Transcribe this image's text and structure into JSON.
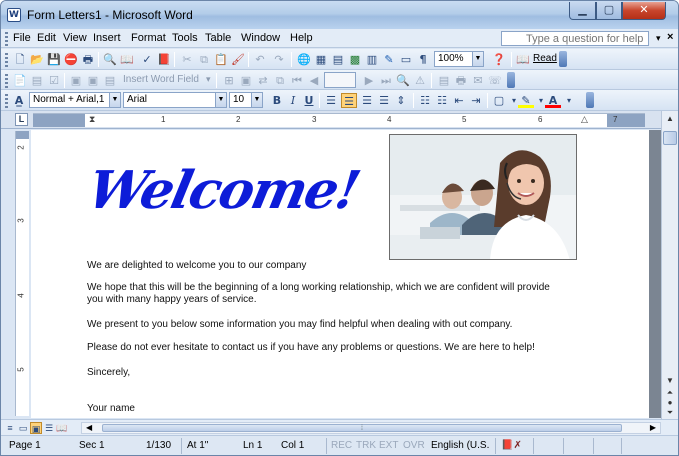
{
  "window": {
    "title": "Form Letters1 - Microsoft Word"
  },
  "menubar": {
    "items": [
      "File",
      "Edit",
      "View",
      "Insert",
      "Format",
      "Tools",
      "Table",
      "Window",
      "Help"
    ],
    "help_placeholder": "Type a question for help"
  },
  "standard_toolbar": {
    "zoom": "100%",
    "read_label": "Read"
  },
  "mail_merge_toolbar": {
    "insert_word_field": "Insert Word Field"
  },
  "formatting_toolbar": {
    "style": "Normal + Arial,1",
    "font": "Arial",
    "size": "10",
    "colors": {
      "highlight": "#ffff00",
      "font_color": "#ff0000"
    }
  },
  "ruler": {
    "numbers": [
      "1",
      "2",
      "3",
      "4",
      "5",
      "6",
      "7"
    ],
    "vnumbers": [
      "2",
      "3",
      "4",
      "5"
    ]
  },
  "document": {
    "heading": "Welcome!",
    "heading_color": "#0d1cd8",
    "paragraphs": [
      "We are delighted to welcome you to our company",
      "We hope that this will be the beginning of a long working relationship, which we are confident will provide",
      "you with many happy years of service.",
      "We present to you below some information you may find helpful when dealing with out company.",
      "Please do not ever hesitate to contact us if you have any problems or questions. We are here to help!",
      "Sincerely,",
      "Your name"
    ]
  },
  "statusbar": {
    "page": "Page 1",
    "sec": "Sec 1",
    "pages": "1/130",
    "at": "At 1\"",
    "ln": "Ln 1",
    "col": "Col 1",
    "rec": "REC",
    "trk": "TRK",
    "ext": "EXT",
    "ovr": "OVR",
    "language": "English (U.S."
  }
}
